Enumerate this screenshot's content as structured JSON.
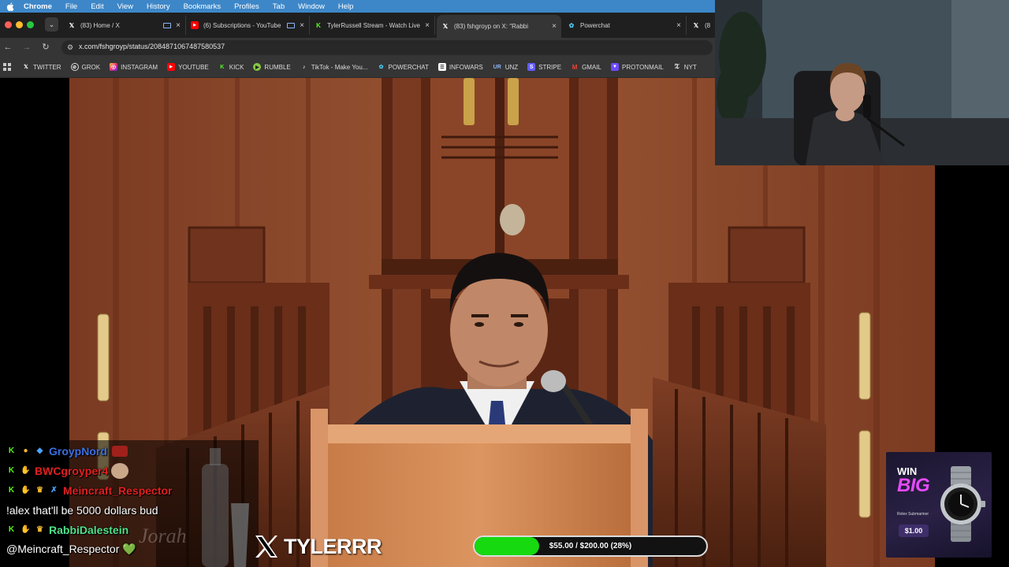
{
  "menubar": {
    "items": [
      "Chrome",
      "File",
      "Edit",
      "View",
      "History",
      "Bookmarks",
      "Profiles",
      "Tab",
      "Window",
      "Help"
    ]
  },
  "tabs": [
    {
      "title": "(83) Home / X",
      "favicon": "x-logo-icon",
      "active": false
    },
    {
      "title": "(6) Subscriptions - YouTube",
      "favicon": "youtube-icon",
      "active": false
    },
    {
      "title": "TylerRussell Stream - Watch Live",
      "favicon": "kick-icon",
      "active": false
    },
    {
      "title": "(83) fshgroyp on X: \"Rabbi",
      "favicon": "x-logo-icon",
      "active": true
    },
    {
      "title": "Powerchat",
      "favicon": "powerchat-icon",
      "active": false
    },
    {
      "title": "(8",
      "favicon": "x-logo-icon",
      "active": false
    }
  ],
  "address": {
    "url": "x.com/fshgroyp/status/2084871067487580537"
  },
  "bookmarks": [
    {
      "label": "TWITTER",
      "icon": "x-logo-icon"
    },
    {
      "label": "GROK",
      "icon": "grok-icon"
    },
    {
      "label": "INSTAGRAM",
      "icon": "instagram-icon"
    },
    {
      "label": "YOUTUBE",
      "icon": "youtube-icon"
    },
    {
      "label": "KICK",
      "icon": "kick-icon"
    },
    {
      "label": "RUMBLE",
      "icon": "rumble-icon"
    },
    {
      "label": "TikTok - Make You...",
      "icon": "tiktok-icon"
    },
    {
      "label": "POWERCHAT",
      "icon": "powerchat-icon"
    },
    {
      "label": "INFOWARS",
      "icon": "infowars-icon"
    },
    {
      "label": "UNZ",
      "icon": "unz-icon"
    },
    {
      "label": "STRIPE",
      "icon": "stripe-icon"
    },
    {
      "label": "GMAIL",
      "icon": "gmail-icon"
    },
    {
      "label": "PROTONMAIL",
      "icon": "protonmail-icon"
    },
    {
      "label": "NYT",
      "icon": "nyt-icon"
    }
  ],
  "chat": [
    {
      "username": "GroypNord",
      "color": "#3b6fe0",
      "message": ""
    },
    {
      "username": "BWCgroyper4",
      "color": "#e02020",
      "message": ""
    },
    {
      "username": "Meincraft_Respector",
      "color": "#e02020",
      "message": ""
    },
    {
      "username": "",
      "color": "#ffffff",
      "message": "!alex that'll be 5000 dollars bud"
    },
    {
      "username": "RabbiDalestein",
      "color": "#4fe08a",
      "message": ""
    },
    {
      "username": "",
      "color": "#ffffff",
      "message": "@Meincraft_Respector 💚"
    }
  ],
  "brand": {
    "text": "TYLERRR"
  },
  "goal": {
    "text": "$55.00 / $200.00 (28%)",
    "progress": 0.28,
    "fill_color": "#16d90f"
  },
  "promo": {
    "win": "WIN",
    "big": "BIG",
    "product": "Rolex Submariner",
    "price": "$1.00"
  }
}
